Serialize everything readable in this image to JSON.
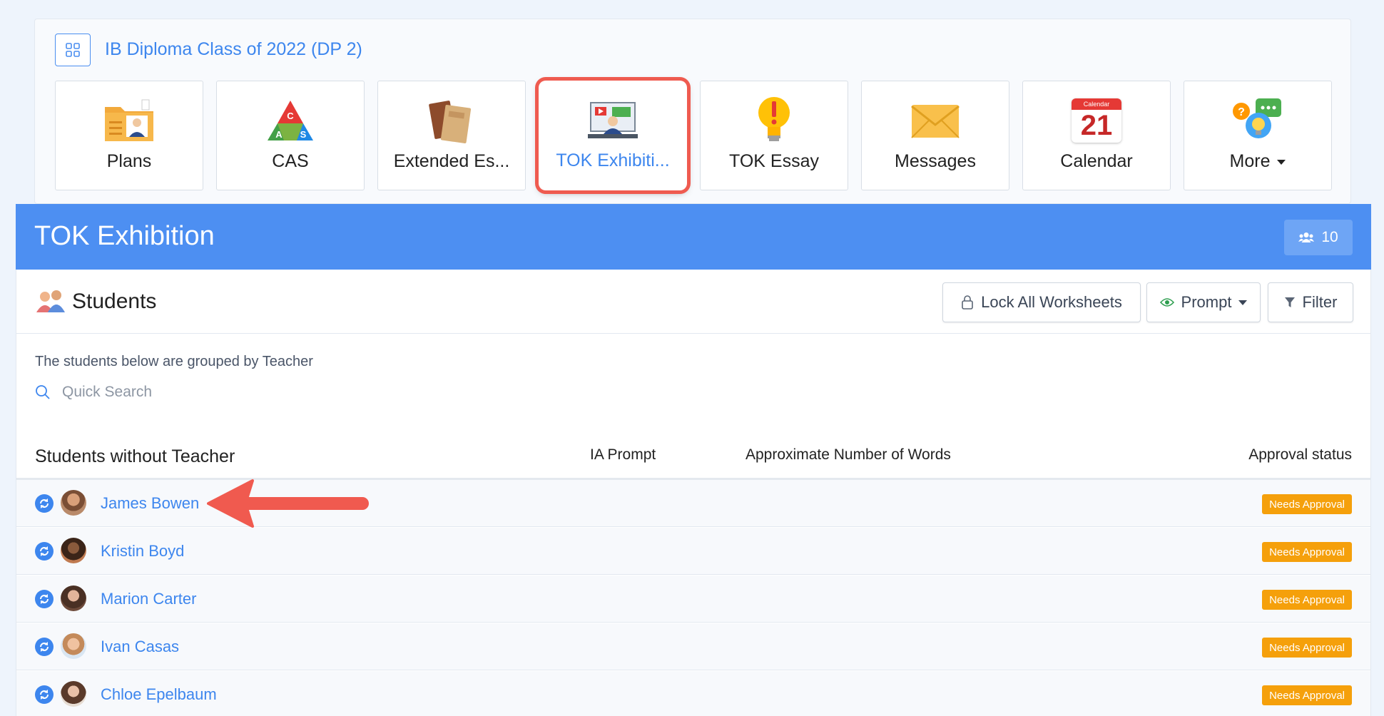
{
  "class": {
    "title": "IB Diploma Class of 2022 (DP 2)"
  },
  "tiles": [
    {
      "label": "Plans",
      "icon": "plans-folder-icon"
    },
    {
      "label": "CAS",
      "icon": "cas-triangle-icon"
    },
    {
      "label": "Extended Es...",
      "icon": "books-icon"
    },
    {
      "label": "TOK Exhibiti...",
      "icon": "presentation-icon"
    },
    {
      "label": "TOK Essay",
      "icon": "lightbulb-icon"
    },
    {
      "label": "Messages",
      "icon": "envelope-icon"
    },
    {
      "label": "Calendar",
      "icon": "calendar-icon",
      "calendar_header": "Calendar",
      "calendar_day": "21"
    },
    {
      "label": "More",
      "icon": "chat-bubbles-icon"
    }
  ],
  "header": {
    "title": "TOK Exhibition",
    "member_count": "10"
  },
  "students": {
    "title": "Students",
    "lock_label": "Lock All Worksheets",
    "prompt_label": "Prompt",
    "filter_label": "Filter",
    "hint": "The students below are grouped by Teacher",
    "search_placeholder": "Quick Search"
  },
  "table": {
    "group_label": "Students without Teacher",
    "columns": [
      "IA Prompt",
      "Approximate Number of Words",
      "Approval status"
    ],
    "rows": [
      {
        "name": "James Bowen",
        "status": "Needs Approval"
      },
      {
        "name": "Kristin Boyd",
        "status": "Needs Approval"
      },
      {
        "name": "Marion Carter",
        "status": "Needs Approval"
      },
      {
        "name": "Ivan Casas",
        "status": "Needs Approval"
      },
      {
        "name": "Chloe Epelbaum",
        "status": "Needs Approval"
      }
    ]
  },
  "colors": {
    "accent": "#3d86ee",
    "header_band": "#4d8ff2",
    "badge": "#f5a00b",
    "highlight": "#ef5b50"
  }
}
